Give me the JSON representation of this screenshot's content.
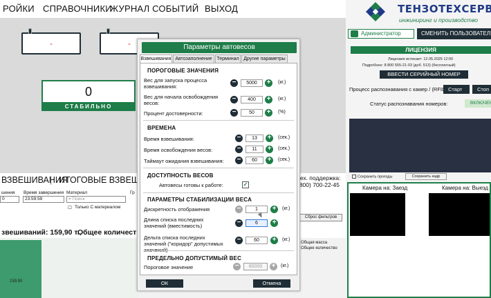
{
  "topmenu": [
    "РОЙКИ",
    "СПРАВОЧНИКИ",
    "ЖУРНАЛ СОБЫТИЙ",
    "ВЫХОД"
  ],
  "weight_boxes": [
    "-",
    "-"
  ],
  "scale": {
    "value": "0",
    "status": "СТАБИЛЬНО"
  },
  "journal": {
    "tab_weighings": "ВЗВЕШИВАНИЯ",
    "tab_totals": "ИТОГОВЫЕ ВЗВЕШИВА",
    "col_weighing": "шения",
    "col_end_time": "Время завершения",
    "col_material": "Материал",
    "col_gr": "Гр",
    "start_value": "0",
    "end_value": "23:59:59",
    "search_placeholder": "Поиск",
    "only_material": "Только С материалом",
    "summary_weighings": "звешиваний: 159,90 т.,",
    "summary_total": "Общее количество",
    "support_line1": "тех. поддержка:",
    "support_line2": "(800) 700-22-45",
    "reset_filters": "Сброс фильтров",
    "total_mass": "Общая масса",
    "total_count": "Общее количество",
    "chart_value": "159,90"
  },
  "right": {
    "logo_title": "ТЕНЗОТЕХСЕРВИС",
    "logo_sub": "инжиниринг и производство",
    "admin": "Администратор",
    "switch_user": "СМЕНИТЬ ПОЛЬЗОВАТЕЛЯ",
    "license": "ЛИЦЕНЗИЯ",
    "license_expires": "Лицензия истекает:   12.05.2025  12:00",
    "support_phone": "Подробнее:   8 800 555-21-03 (доб. 513) (бесплатный)",
    "serial_btn": "ВВЕСТИ СЕРИЙНЫЙ НОМЕР",
    "recognition_label": "Процесс распознавания с камер / (RFID):",
    "start_btn": "Старт",
    "stop_btn": "Стоп",
    "recognition_status": "Статус распознавания номеров:",
    "recognition_on": "ВКЛЮЧЕН",
    "save_frames": "Сохранить проезды",
    "save_frame_btn": "Сохранить кадр",
    "camera_in": "Камера на: Заезд",
    "camera_out": "Камера на: Выезд"
  },
  "modal": {
    "title": "Параметры автовесов",
    "tabs": [
      "Взвешивания",
      "Автозаполнение",
      "Терминал",
      "Другие параметры"
    ],
    "thresholds": {
      "title": "ПОРОГОВЫЕ ЗНАЧЕНИЯ",
      "start_label": "Вес для запуска процесса взвешивания:",
      "start_value": "5000",
      "start_unit": "(кг.)",
      "free_label": "Вес для начала освобождения весов:",
      "free_value": "400",
      "free_unit": "(кг.)",
      "confidence_label": "Процент достоверности:",
      "confidence_value": "50",
      "confidence_unit": "(%)"
    },
    "times": {
      "title": "ВРЕМЕНА",
      "weigh_label": "Время взвешивания:",
      "weigh_value": "13",
      "weigh_unit": "(сек.)",
      "release_label": "Время освобождения весов:",
      "release_value": "11",
      "release_unit": "(сек.)",
      "timeout_label": "Таймаут ожидания взвешивания:",
      "timeout_value": "60",
      "timeout_unit": "(сек.)"
    },
    "availability": {
      "title": "ДОСТУПНОСТЬ ВЕСОВ",
      "ready_label": "Автовесы готовы к работе:",
      "ready_checked": "✓"
    },
    "stabilization": {
      "title": "ПАРАМЕТРЫ СТАБИЛИЗАЦИИ ВЕСА",
      "discrete_label": "Дискретность отображения",
      "discrete_value": "1",
      "discrete_unit": "(кг.)",
      "list_len_label": "Длина списка последних значений (вместимость)",
      "list_len_value": "6",
      "delta_label": "Дельта списка последних значений (\"коридор\" допустимых значений)",
      "delta_value": "60",
      "delta_unit": "(кг.)"
    },
    "limit": {
      "title": "ПРЕДЕЛЬНО ДОПУСТИМЫЙ ВЕС",
      "threshold_label": "Пороговое значение",
      "threshold_value": "80000",
      "threshold_unit": "(кг.)"
    },
    "ok": "ОК",
    "cancel": "Отмена"
  }
}
